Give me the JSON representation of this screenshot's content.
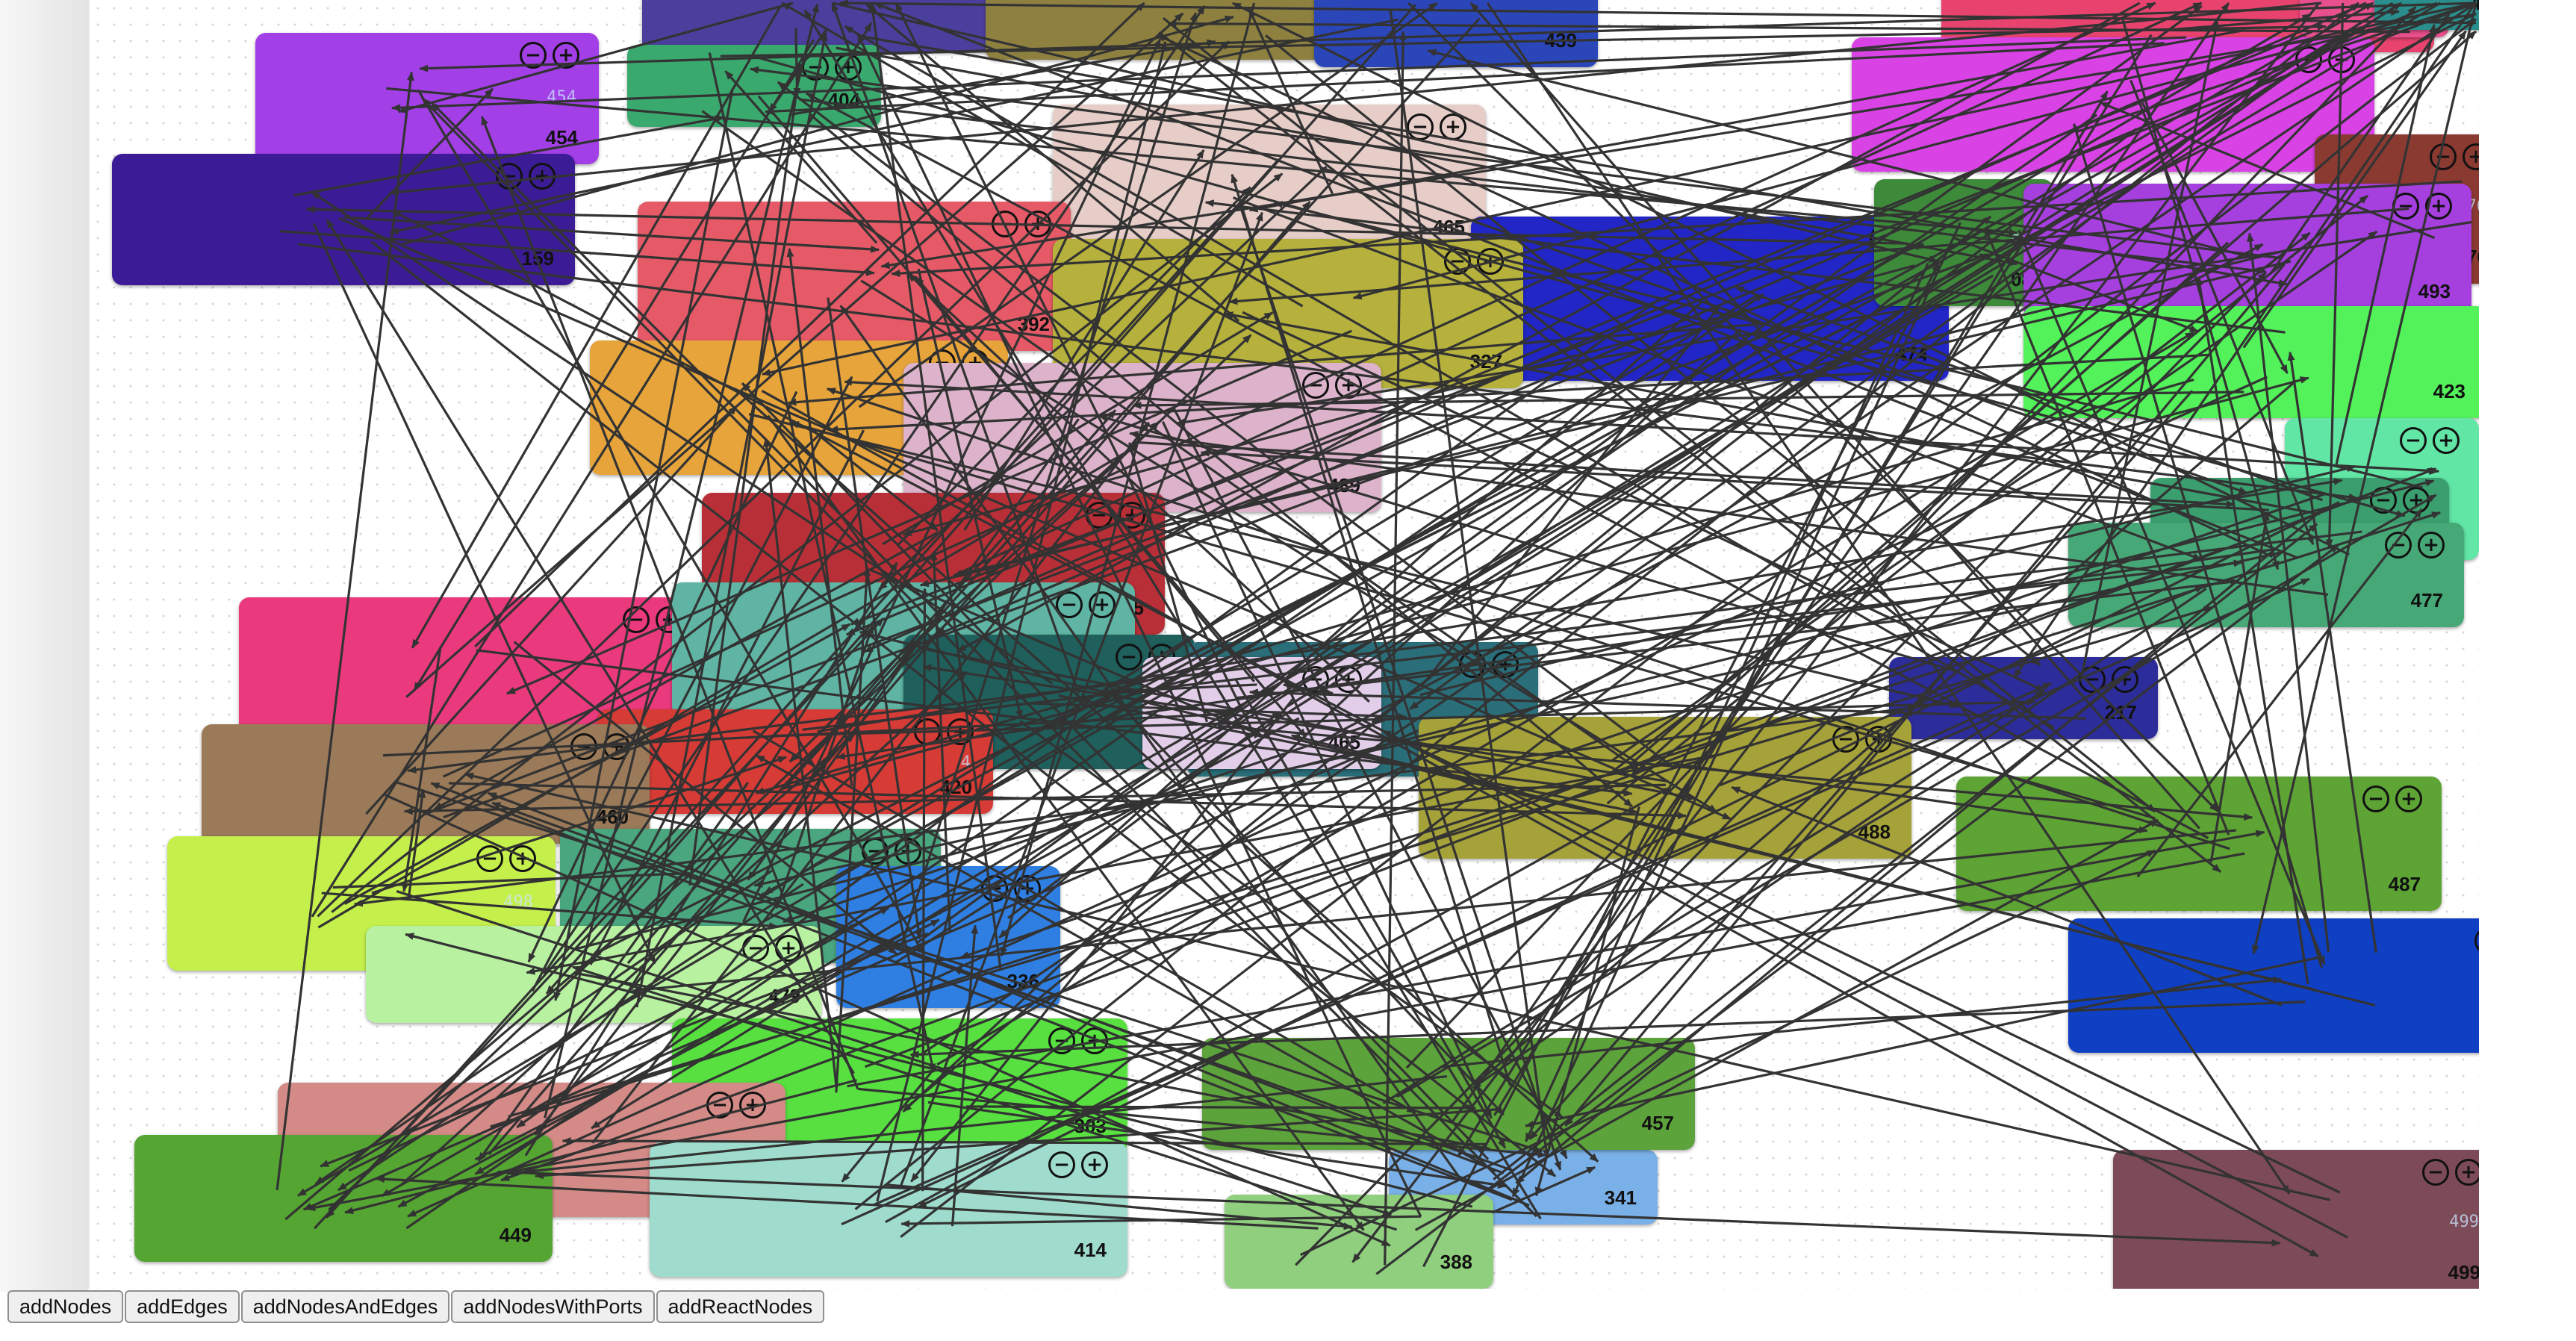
{
  "toolbar": {
    "buttons": [
      {
        "label": "addNodes"
      },
      {
        "label": "addEdges"
      },
      {
        "label": "addNodesAndEdges"
      },
      {
        "label": "addNodesWithPorts"
      },
      {
        "label": "addReactNodes"
      }
    ]
  },
  "controls": {
    "collapse_symbol": "−",
    "expand_symbol": "+"
  },
  "nodes": [
    {
      "id": "43",
      "color": "#4b3f9e",
      "ghost": "",
      "controls": false
    },
    {
      "id": "478",
      "color": "#8e8140",
      "ghost": "",
      "controls": false
    },
    {
      "id": "439",
      "color": "#2b46b8",
      "ghost": "",
      "controls": false
    },
    {
      "id": "491",
      "color": "#e8436f",
      "ghost": "",
      "controls": true
    },
    {
      "id": "73",
      "color": "#e84f8d",
      "ghost": "",
      "controls": false
    },
    {
      "id": "431",
      "color": "#2a8e8c",
      "ghost": "",
      "controls": false
    },
    {
      "id": "404",
      "color": "#3aa96e",
      "ghost": "",
      "controls": true
    },
    {
      "id": "454",
      "color": "#a23fe7",
      "ghost": "454",
      "controls": true
    },
    {
      "id": "159",
      "color": "#3c1c96",
      "ghost": "",
      "controls": true
    },
    {
      "id": "485",
      "color": "#d942e5",
      "ghost": "",
      "controls": true
    },
    {
      "id": "465",
      "color": "#e6cdc8",
      "ghost": "",
      "controls": true
    },
    {
      "id": "476",
      "color": "#8b3a32",
      "ghost": "476",
      "controls": true
    },
    {
      "id": "392",
      "color": "#e55a66",
      "ghost": "",
      "controls": true
    },
    {
      "id": "474",
      "color": "#2226c7",
      "ghost": "474",
      "controls": true
    },
    {
      "id": "08",
      "color": "#3d8a3b",
      "ghost": "08",
      "controls": false
    },
    {
      "id": "493",
      "color": "#a53fde",
      "ghost": "",
      "controls": true
    },
    {
      "id": "327",
      "color": "#b5b13c",
      "ghost": "",
      "controls": true
    },
    {
      "id": "457",
      "color": "#e7a43b",
      "ghost": "",
      "controls": true
    },
    {
      "id": "423",
      "color": "#53f15a",
      "ghost": "",
      "controls": false
    },
    {
      "id": "489",
      "color": "#dcb3cb",
      "ghost": "",
      "controls": true
    },
    {
      "id": "30",
      "color": "#61e6a6",
      "ghost": "",
      "controls": true
    },
    {
      "id": "39",
      "color": "#3b9e6e",
      "ghost": "",
      "controls": true
    },
    {
      "id": "495",
      "color": "#b92f37",
      "ghost": "",
      "controls": true
    },
    {
      "id": "477",
      "color": "#47a877",
      "ghost": "",
      "controls": true
    },
    {
      "id": "256",
      "color": "#ea3a7d",
      "ghost": "",
      "controls": true
    },
    {
      "id": "452",
      "color": "#5fb4a3",
      "ghost": "",
      "controls": true
    },
    {
      "id": "371",
      "color": "#1f5f5c",
      "ghost": "",
      "controls": true
    },
    {
      "id": "324",
      "color": "#2a6e7a",
      "ghost": "",
      "controls": true
    },
    {
      "id": "465",
      "color": "#e3ceea",
      "ghost": "",
      "controls": true
    },
    {
      "id": "217",
      "color": "#2d2c9b",
      "ghost": "",
      "controls": true
    },
    {
      "id": "420",
      "color": "#d63b36",
      "ghost": "4",
      "controls": true
    },
    {
      "id": "460",
      "color": "#9a7a58",
      "ghost": "",
      "controls": true
    },
    {
      "id": "488",
      "color": "#a6a23a",
      "ghost": "",
      "controls": true
    },
    {
      "id": "498",
      "color": "#c5f04c",
      "ghost": "498",
      "controls": true
    },
    {
      "id": "497",
      "color": "#4aa67e",
      "ghost": "",
      "controls": true
    },
    {
      "id": "336",
      "color": "#2f7fe2",
      "ghost": "",
      "controls": true
    },
    {
      "id": "479",
      "color": "#b8f2a1",
      "ghost": "",
      "controls": true
    },
    {
      "id": "487",
      "color": "#5da434",
      "ghost": "",
      "controls": true
    },
    {
      "id": "494",
      "color": "#0f3fc2",
      "ghost": "",
      "controls": true
    },
    {
      "id": "303",
      "color": "#58e041",
      "ghost": "",
      "controls": true
    },
    {
      "id": "453",
      "color": "#d48a86",
      "ghost": "",
      "controls": true
    },
    {
      "id": "376",
      "color": "#62a9e6",
      "ghost": "",
      "controls": false
    },
    {
      "id": "341",
      "color": "#7ab0e8",
      "ghost": "",
      "controls": false
    },
    {
      "id": "457",
      "color": "#5da33b",
      "ghost": "",
      "controls": false
    },
    {
      "id": "388",
      "color": "#8fcf7d",
      "ghost": "",
      "controls": false
    },
    {
      "id": "449",
      "color": "#55a533",
      "ghost": "",
      "controls": false
    },
    {
      "id": "414",
      "color": "#9fdccd",
      "ghost": "",
      "controls": true
    },
    {
      "id": "499",
      "color": "#7d4a58",
      "ghost": "499",
      "controls": true
    }
  ]
}
